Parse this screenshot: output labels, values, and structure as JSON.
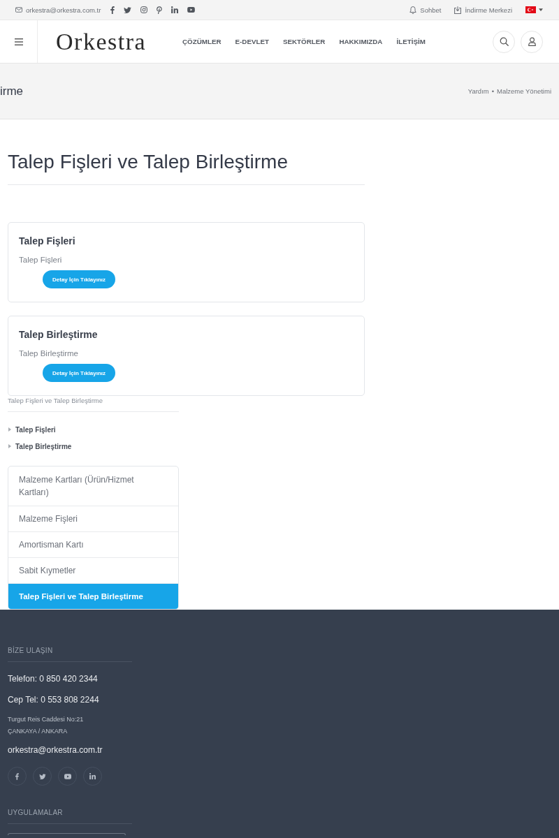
{
  "top_bar": {
    "email": "orkestra@orkestra.com.tr",
    "chat": "Sohbet",
    "downloads": "İndirme Merkezi"
  },
  "header": {
    "logo": "Orkestra",
    "nav": [
      "ÇÖZÜMLER",
      "E-DEVLET",
      "SEKTÖRLER",
      "HAKKIMIZDA",
      "İLETİŞİM"
    ]
  },
  "title_bar": {
    "title": "irme",
    "breadcrumb": [
      "Yardım",
      "Malzeme Yönetimi"
    ],
    "separator": "•"
  },
  "content": {
    "heading": "Talep Fişleri ve Talep Birleştirme",
    "cards": [
      {
        "title": "Talep Fişleri",
        "description": "Talep Fişleri",
        "button": "Detay İçin Tıklayınız"
      },
      {
        "title": "Talep Birleştirme",
        "description": "Talep Birleştirme",
        "button": "Detay İçin Tıklayınız"
      }
    ]
  },
  "sidebar": {
    "title": "Talep Fişleri ve Talep Birleştirme",
    "links": [
      "Talep Fişleri",
      "Talep Birleştirme"
    ],
    "menu": [
      {
        "label": "Malzeme Kartları (Ürün/Hizmet Kartları)",
        "selected": false
      },
      {
        "label": "Malzeme Fişleri",
        "selected": false
      },
      {
        "label": "Amortisman Kartı",
        "selected": false
      },
      {
        "label": "Sabit Kıymetler",
        "selected": false
      },
      {
        "label": "Talep Fişleri ve Talep Birleştirme",
        "selected": true
      }
    ]
  },
  "footer": {
    "contact_heading": "BİZE ULAŞIN",
    "phone": "Telefon: 0 850 420 2344",
    "mobile": "Cep Tel: 0 553 808 2244",
    "address": [
      "Turgut Reis Caddesi No:21",
      "ÇANKAYA / ANKARA"
    ],
    "email": "orkestra@orkestra.com.tr",
    "apps_heading": "UYGULAMALAR"
  }
}
